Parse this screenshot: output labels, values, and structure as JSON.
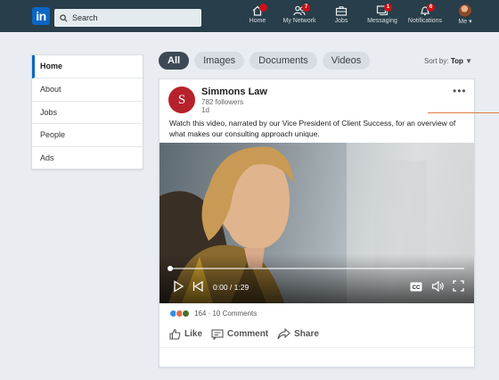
{
  "header": {
    "logo_text": "in",
    "search_placeholder": "Search",
    "nav": [
      {
        "label": "Home",
        "icon": "home-icon",
        "badge": ""
      },
      {
        "label": "My Network",
        "icon": "network-icon",
        "badge": "7"
      },
      {
        "label": "Jobs",
        "icon": "briefcase-icon",
        "badge": ""
      },
      {
        "label": "Messaging",
        "icon": "messaging-icon",
        "badge": "1"
      },
      {
        "label": "Notifications",
        "icon": "bell-icon",
        "badge": "6"
      },
      {
        "label": "Me",
        "icon": "avatar-icon",
        "badge": ""
      }
    ],
    "badge_color": "#cc1016"
  },
  "sidebar": {
    "items": [
      {
        "label": "Home",
        "active": true
      },
      {
        "label": "About",
        "active": false
      },
      {
        "label": "Jobs",
        "active": false
      },
      {
        "label": "People",
        "active": false
      },
      {
        "label": "Ads",
        "active": false
      }
    ]
  },
  "filters": {
    "pills": [
      {
        "label": "All",
        "active": true
      },
      {
        "label": "Images",
        "active": false
      },
      {
        "label": "Documents",
        "active": false
      },
      {
        "label": "Videos",
        "active": false
      }
    ],
    "sort_label": "Sort by:",
    "sort_value": "Top"
  },
  "post": {
    "company_initial": "S",
    "company_name": "Simmons Law",
    "followers": "782 followers",
    "age": "1d",
    "text": "Watch this video, narrated by our Vice President of Client Success, for an overview of what makes our consulting approach unique.",
    "video": {
      "time": "0:00 / 1:29",
      "progress": 0,
      "cc_label": "CC"
    },
    "reactions_count": "164",
    "comments_count": "10 Comments",
    "actions": {
      "like": "Like",
      "comment": "Comment",
      "share": "Share"
    }
  },
  "colors": {
    "header_bg": "#283e4a",
    "brand_blue": "#0a66c2",
    "company_logo": "#b6222c"
  }
}
